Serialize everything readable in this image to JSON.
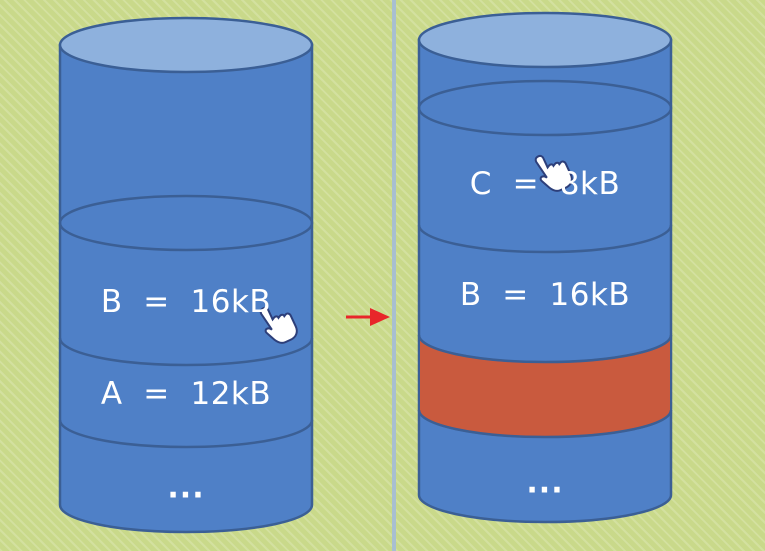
{
  "colors": {
    "cylinder_fill": "#4f80c7",
    "cylinder_stroke": "#3b5f95",
    "cylinder_top": "#8eb1dd",
    "freed_block": "#c95a3e",
    "arrow": "#e8262a",
    "background": "#c9d98a"
  },
  "left_stack": {
    "segments": [
      {
        "label": "B  =  16kB"
      },
      {
        "label": "A  =  12kB"
      }
    ],
    "ellipsis": "..."
  },
  "right_stack": {
    "segments": [
      {
        "label": "C  =  8kB"
      },
      {
        "label": "B  =  16kB"
      }
    ],
    "ellipsis": "..."
  },
  "cursor_icon": "hand-pointer-icon"
}
